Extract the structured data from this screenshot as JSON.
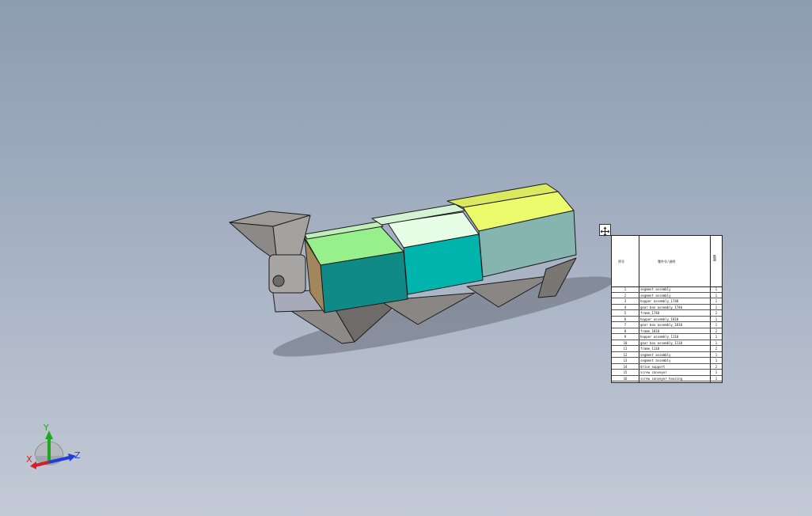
{
  "triad": {
    "x_label": "X",
    "y_label": "Y",
    "z_label": "Z",
    "colors": {
      "x": "#d42020",
      "y": "#1fa81f",
      "z": "#1f3fd4"
    }
  },
  "model_colors": {
    "section1_top": "#98f08c",
    "section1_side": "#0f8a86",
    "section2_top": "#e6fde6",
    "section2_side": "#00b4ae",
    "section3_top": "#eafc6c",
    "section3_side": "#86b4ae",
    "metal": "#8a8684"
  },
  "bom": {
    "header_item": "序号",
    "header_desc": "零件号/说明",
    "header_qty": "数量",
    "rows": [
      {
        "no": "1",
        "desc": "segment assembly",
        "qty": "1"
      },
      {
        "no": "2",
        "desc": "segment assembly",
        "qty": "1"
      },
      {
        "no": "3",
        "desc": "hopper assembly_1740",
        "qty": "1"
      },
      {
        "no": "4",
        "desc": "gear box assembly_1740",
        "qty": "1"
      },
      {
        "no": "5",
        "desc": "frame_1740",
        "qty": "2"
      },
      {
        "no": "6",
        "desc": "hopper assembly_1810",
        "qty": "1"
      },
      {
        "no": "7",
        "desc": "gear box assembly_1810",
        "qty": "1"
      },
      {
        "no": "8",
        "desc": "frame_1810",
        "qty": "2"
      },
      {
        "no": "9",
        "desc": "hopper assembly_1110",
        "qty": "1"
      },
      {
        "no": "10",
        "desc": "gear box assembly_1110",
        "qty": "1"
      },
      {
        "no": "11",
        "desc": "frame_1110",
        "qty": "2"
      },
      {
        "no": "12",
        "desc": "segment assembly",
        "qty": "1"
      },
      {
        "no": "13",
        "desc": "segment assembly",
        "qty": "1"
      },
      {
        "no": "14",
        "desc": "drive support",
        "qty": "2"
      },
      {
        "no": "15",
        "desc": "screw conveyor",
        "qty": "1"
      },
      {
        "no": "16",
        "desc": "screw conveyor housing",
        "qty": "1"
      }
    ]
  }
}
